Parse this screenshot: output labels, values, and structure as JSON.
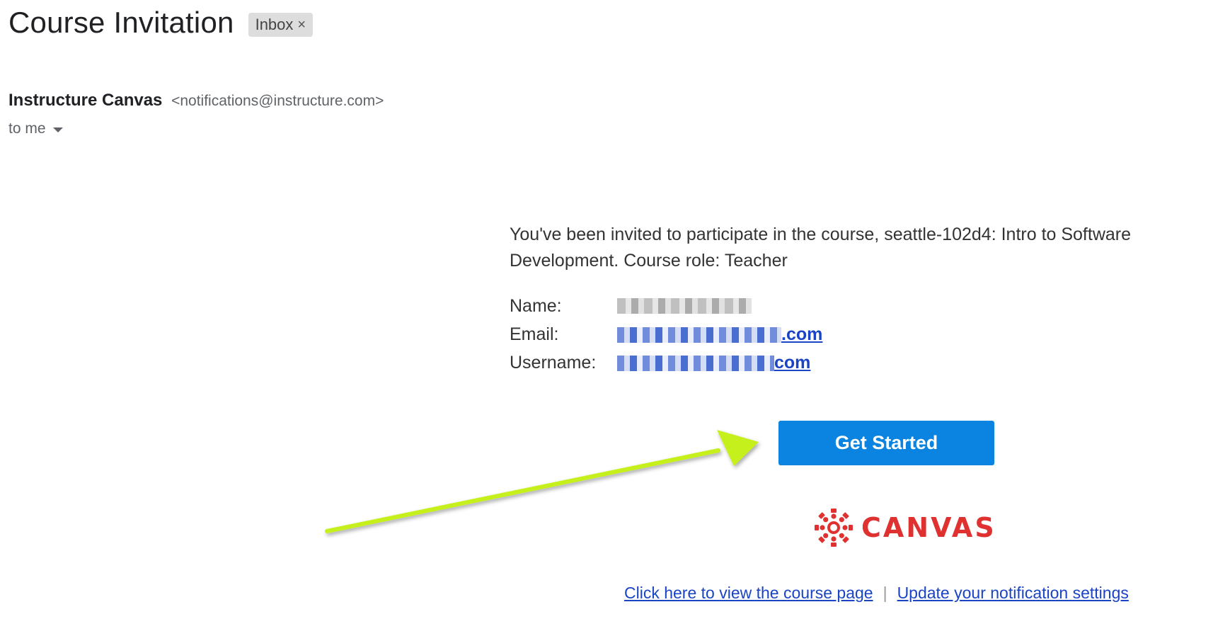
{
  "email": {
    "subject": "Course Invitation",
    "label": "Inbox",
    "label_remove": "×",
    "sender_name": "Instructure Canvas",
    "sender_email": "<notifications@instructure.com>",
    "recipients": "to me"
  },
  "body": {
    "invite_text": "You've been invited to participate in the course, seattle-102d4: Intro to Software Development. Course role: Teacher",
    "details": {
      "name_label": "Name:",
      "email_label": "Email:",
      "email_suffix": ".com",
      "username_label": "Username:",
      "username_suffix": "com"
    },
    "cta": "Get Started",
    "logo_text": "CANVAS",
    "links": {
      "course_page": "Click here to view the course page",
      "separator": "|",
      "notification_settings": "Update your notification settings"
    }
  },
  "colors": {
    "button": "#0a84e0",
    "link": "#1a44c4",
    "logo": "#e03131",
    "arrow": "#c6f01c"
  }
}
